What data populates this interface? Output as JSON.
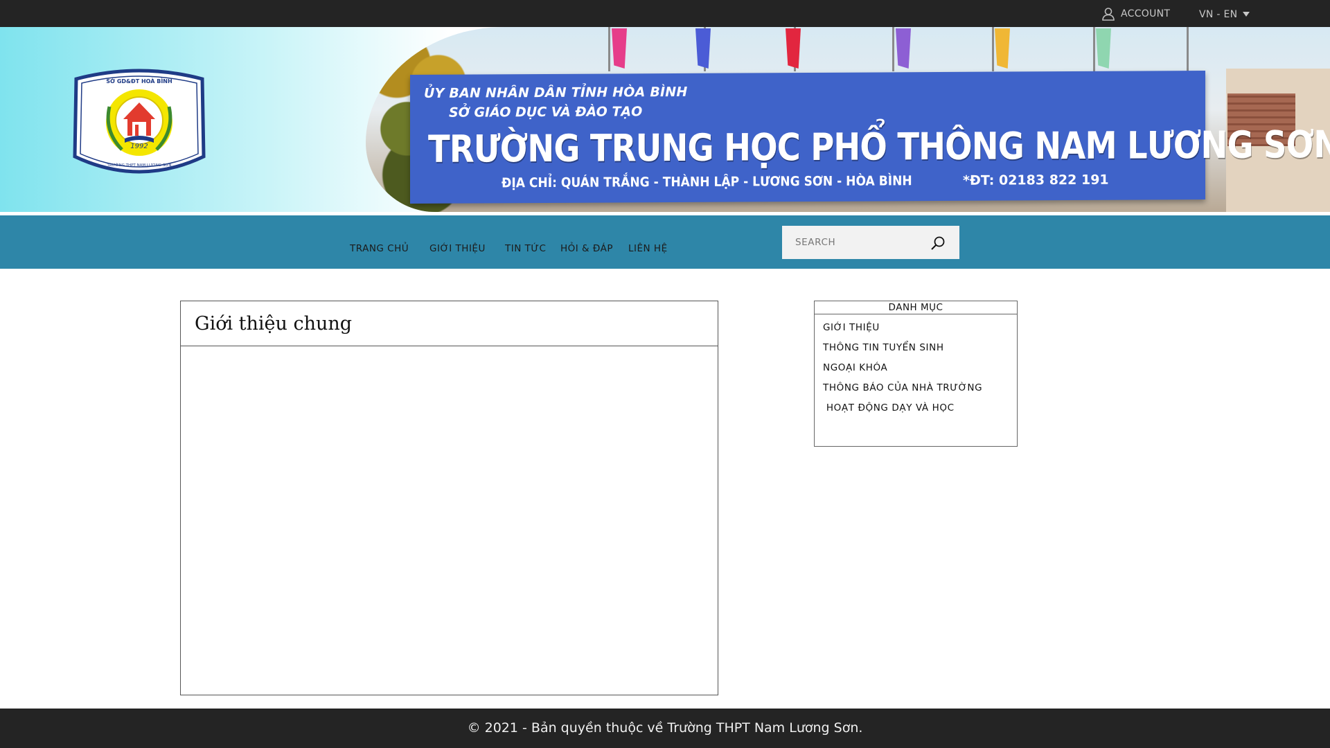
{
  "topbar": {
    "account_label": "ACCOUNT",
    "account_icon": "user-icon",
    "language_label": "VN - EN",
    "language_icon": "caret-down-icon"
  },
  "banner": {
    "logo": {
      "top_text": "SỞ GD&ĐT HOÀ BÌNH",
      "year": "1992",
      "bottom_text": "TRƯỜNG THPT NAM LƯƠNG SƠN"
    },
    "sign": {
      "line1": "ỦY BAN NHÂN DÂN TỈNH HÒA BÌNH",
      "line2": "SỞ GIÁO DỤC VÀ ĐÀO TẠO",
      "line3": "TRƯỜNG TRUNG HỌC PHỔ THÔNG NAM LƯƠNG SƠN",
      "address": "ĐỊA CHỈ: QUÁN TRẮNG - THÀNH LẬP - LƯƠNG SƠN - HÒA BÌNH",
      "phone": "*ĐT: 02183 822 191"
    },
    "colors": {
      "sign": "#3f63c9",
      "gradient_start": "#7fe3ee"
    }
  },
  "nav": {
    "items": [
      {
        "label": "TRANG CHỦ"
      },
      {
        "label": "GIỚI THIỆU"
      },
      {
        "label": "TIN TỨC"
      },
      {
        "label": "HỎI & ĐÁP"
      },
      {
        "label": "LIÊN HỆ"
      }
    ],
    "search": {
      "placeholder": "SEARCH",
      "value": "",
      "icon": "search-icon"
    },
    "color": "#2e86a8"
  },
  "main": {
    "title": "Giới thiệu chung"
  },
  "sidebar": {
    "title": "DANH MỤC",
    "items": [
      {
        "label": "GIỚI THIỆU"
      },
      {
        "label": "THÔNG TIN TUYỂN SINH"
      },
      {
        "label": "NGOẠI KHÓA"
      },
      {
        "label": "THÔNG BÁO CỦA NHÀ TRƯỜNG"
      },
      {
        "label": " HOẠT ĐỘNG DẠY VÀ HỌC"
      }
    ]
  },
  "footer": {
    "text": "© 2021 - Bản quyền thuộc về Trường THPT Nam Lương Sơn."
  }
}
